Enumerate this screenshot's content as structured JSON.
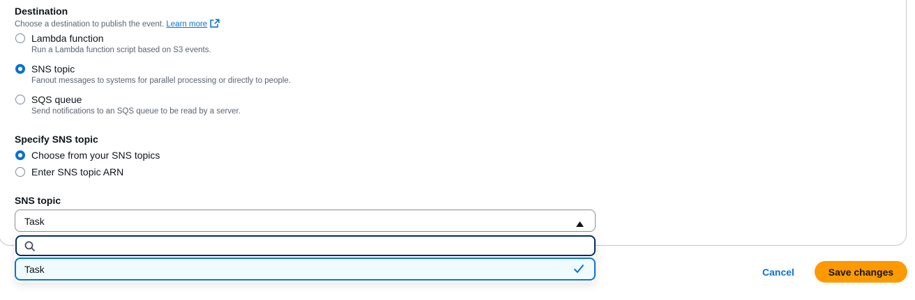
{
  "destination": {
    "heading": "Destination",
    "description": "Choose a destination to publish the event.",
    "learn_more": "Learn more",
    "options": [
      {
        "label": "Lambda function",
        "description": "Run a Lambda function script based on S3 events.",
        "selected": false
      },
      {
        "label": "SNS topic",
        "description": "Fanout messages to systems for parallel processing or directly to people.",
        "selected": true
      },
      {
        "label": "SQS queue",
        "description": "Send notifications to an SQS queue to be read by a server.",
        "selected": false
      }
    ]
  },
  "specify_sns": {
    "heading": "Specify SNS topic",
    "options": [
      {
        "label": "Choose from your SNS topics",
        "selected": true
      },
      {
        "label": "Enter SNS topic ARN",
        "selected": false
      }
    ]
  },
  "sns_topic": {
    "label": "SNS topic",
    "selected_value": "Task",
    "search_placeholder": "",
    "options": [
      {
        "label": "Task",
        "selected": true
      }
    ]
  },
  "actions": {
    "cancel_label": "Cancel",
    "save_label": "Save changes"
  },
  "colors": {
    "accent": "#0972d3",
    "primary_button": "#ff9900",
    "focus_border": "#002b66"
  },
  "icons": {
    "external_link": "external-link-icon",
    "caret": "caret-up-icon",
    "search": "search-icon",
    "check": "check-icon"
  }
}
